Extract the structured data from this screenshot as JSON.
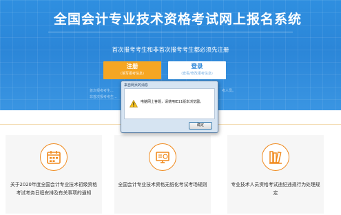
{
  "header": {
    "title": "全国会计专业技术资格考试网上报名系统",
    "subtitle": "首次报考考生和非首次报考考生都必须先注册"
  },
  "buttons": {
    "register": {
      "label": "注册",
      "sub": "(填写报考信息)"
    },
    "login": {
      "label": "登录",
      "sub": "(查看/修改报考信息)"
    }
  },
  "hints": {
    "line1": "首次报考考生...",
    "line2": "非首次报考考生...",
    "right": "考人员。"
  },
  "cards": [
    {
      "text": "关于2020年度全国会计专业技术初级资格考试考务日程安排及有关事项的通知",
      "icon": "calendar-icon"
    },
    {
      "text": "全国会计专业技术资格无纸化考试考场规则",
      "icon": "monitor-icon"
    },
    {
      "text": "专业技术人员资格考试违纪违规行为处理规定",
      "icon": "books-icon"
    }
  ],
  "dialog": {
    "title": "来自网页的消息",
    "message": "电脑网上答题，请使用IE11版本浏览器。",
    "ok_label": "确定"
  },
  "colors": {
    "header_blue": "#2b86d8",
    "accent_orange": "#f5a623",
    "icon_orange": "#f08a1e"
  }
}
